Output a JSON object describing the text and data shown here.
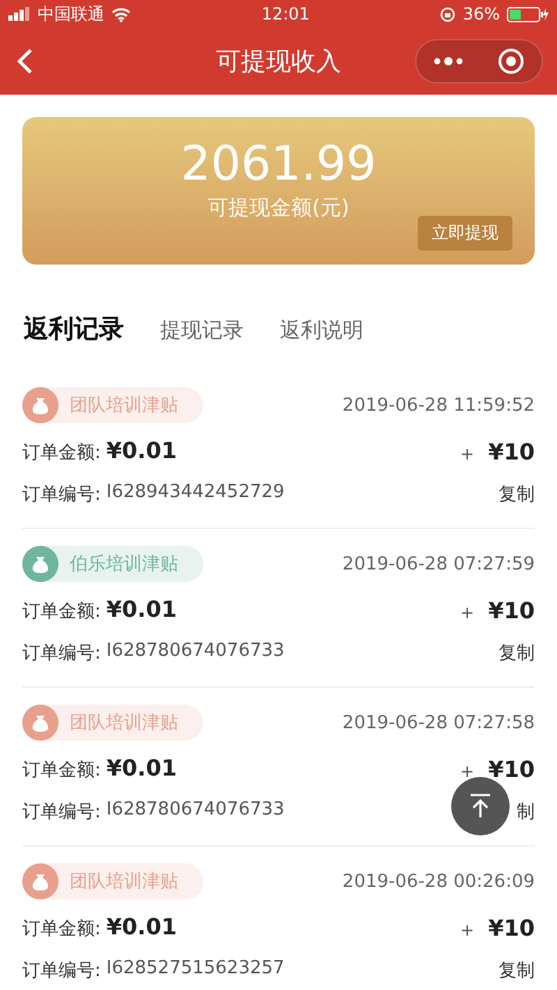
{
  "status_bar": {
    "carrier": "中国联通",
    "time": "12:01",
    "battery": "36%"
  },
  "nav": {
    "title": "可提现收入"
  },
  "balance": {
    "amount": "2061.99",
    "label": "可提现金额(元)",
    "button": "立即提现"
  },
  "tabs": [
    {
      "label": "返利记录",
      "selected": true
    },
    {
      "label": "提现记录",
      "selected": false
    },
    {
      "label": "返利说明",
      "selected": false
    }
  ],
  "records": [
    {
      "tag": "团队培训津贴",
      "color": "#e8a08c",
      "time": "2019-06-28 11:59:52",
      "amount_label": "订单金额:",
      "amount": "¥0.01",
      "plus": "+",
      "reward": "¥10",
      "order_label": "订单编号:",
      "order_no": "I628943442452729",
      "copy": "复制"
    },
    {
      "tag": "伯乐培训津贴",
      "color": "#6fb5a0",
      "time": "2019-06-28 07:27:59",
      "amount_label": "订单金额:",
      "amount": "¥0.01",
      "plus": "+",
      "reward": "¥10",
      "order_label": "订单编号:",
      "order_no": "I628780674076733",
      "copy": "复制"
    },
    {
      "tag": "团队培训津贴",
      "color": "#e8a08c",
      "time": "2019-06-28 07:27:58",
      "amount_label": "订单金额:",
      "amount": "¥0.01",
      "plus": "+",
      "reward": "¥10",
      "order_label": "订单编号:",
      "order_no": "I628780674076733",
      "copy": "制"
    },
    {
      "tag": "团队培训津贴",
      "color": "#e8a08c",
      "time": "2019-06-28 00:26:09",
      "amount_label": "订单金额:",
      "amount": "¥0.01",
      "plus": "+",
      "reward": "¥10",
      "order_label": "订单编号:",
      "order_no": "I628527515623257",
      "copy": "复制"
    }
  ]
}
